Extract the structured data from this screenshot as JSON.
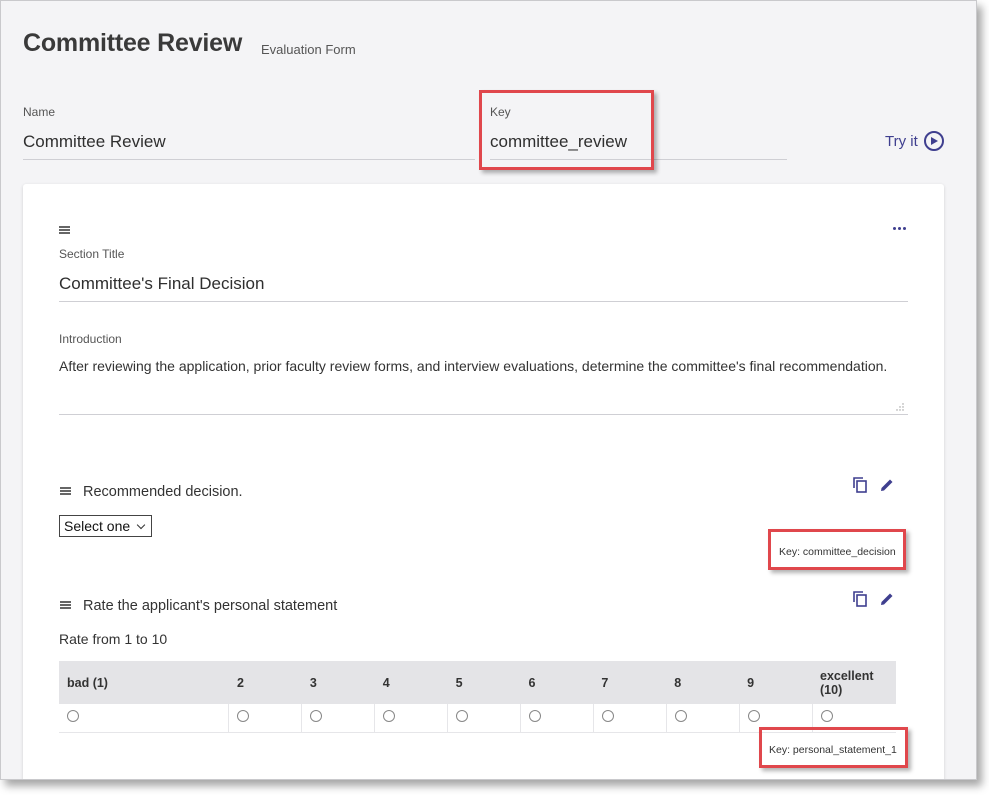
{
  "header": {
    "title": "Committee Review",
    "subtitle": "Evaluation Form"
  },
  "fields": {
    "name_label": "Name",
    "name_value": "Committee Review",
    "key_label": "Key",
    "key_value": "committee_review"
  },
  "try_it": {
    "label": "Try it",
    "icon": "play-circle-icon"
  },
  "section": {
    "title_label": "Section Title",
    "title_value": "Committee's Final Decision",
    "intro_label": "Introduction",
    "intro_value": "After reviewing the application, prior faculty review forms, and interview evaluations, determine the committee's final recommendation."
  },
  "questions": [
    {
      "text": "Recommended decision.",
      "select_value": "Select one",
      "key_note": "Key: committee_decision"
    },
    {
      "text": "Rate the applicant's personal statement",
      "rate_label": "Rate from 1 to 10",
      "scale_headers": [
        "bad (1)",
        "2",
        "3",
        "4",
        "5",
        "6",
        "7",
        "8",
        "9",
        "excellent (10)"
      ],
      "key_note": "Key: personal_statement_1"
    }
  ],
  "colors": {
    "accent": "#3f3f8f",
    "highlight": "#e0474c",
    "background": "#f4f4f6"
  }
}
